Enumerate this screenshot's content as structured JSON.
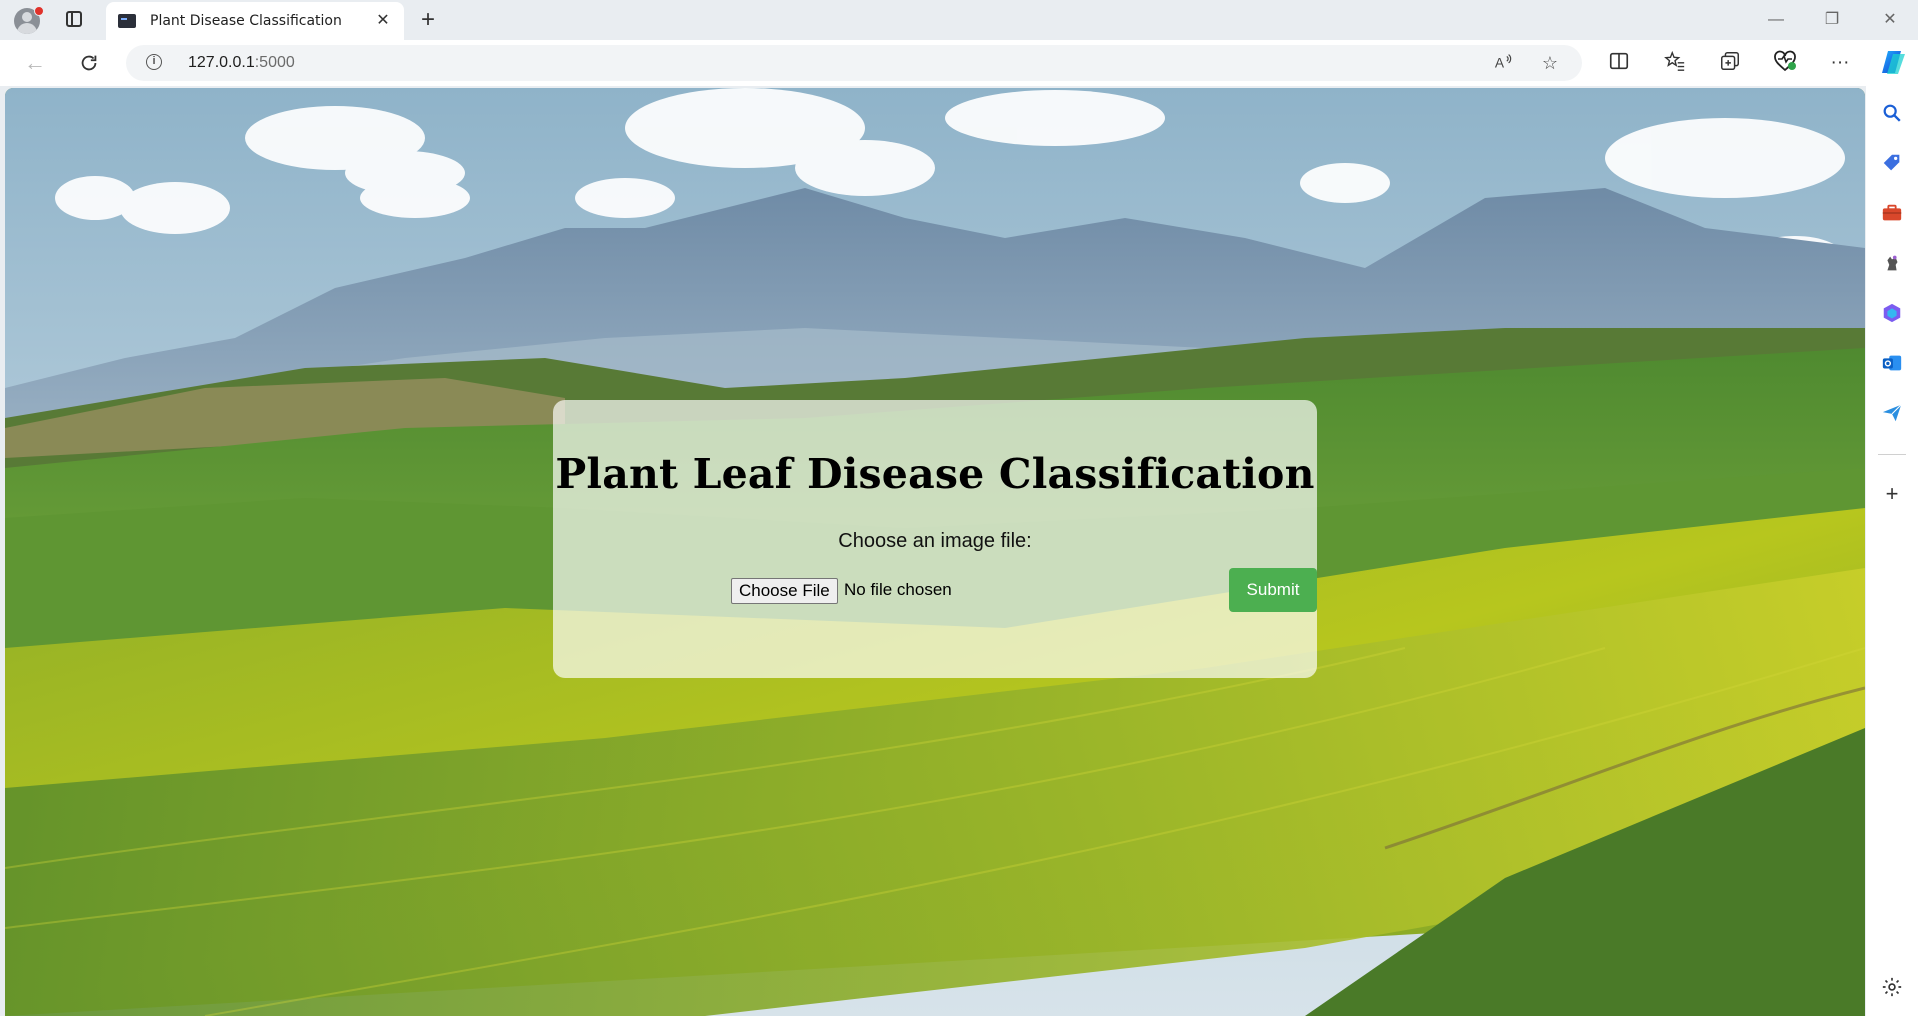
{
  "browser": {
    "tab_title": "Plant Disease Classification",
    "tab_close": "✕",
    "new_tab": "+",
    "url_host": "127.0.0.1",
    "url_port": ":5000",
    "window_controls": {
      "minimize": "—",
      "restore": "❐",
      "close": "✕"
    },
    "toolbar_icons": [
      "read-aloud-icon",
      "favorite-star-icon",
      "split-screen-icon",
      "favorites-icon",
      "collections-icon",
      "browser-essentials-icon",
      "more-menu-icon",
      "copilot-icon"
    ]
  },
  "sidebar": {
    "icons": [
      "search-icon",
      "shopping-tag-icon",
      "tools-briefcase-icon",
      "games-icon",
      "microsoft365-icon",
      "outlook-icon",
      "send-icon",
      "add-icon",
      "settings-icon"
    ]
  },
  "page": {
    "heading": "Plant Leaf Disease Classification",
    "file_label": "Choose an image file:",
    "choose_file_button": "Choose File",
    "file_status": "No file chosen",
    "submit_button": "Submit"
  },
  "colors": {
    "submit_green": "#4caf50",
    "copilot_blue": "#1a73e8"
  }
}
